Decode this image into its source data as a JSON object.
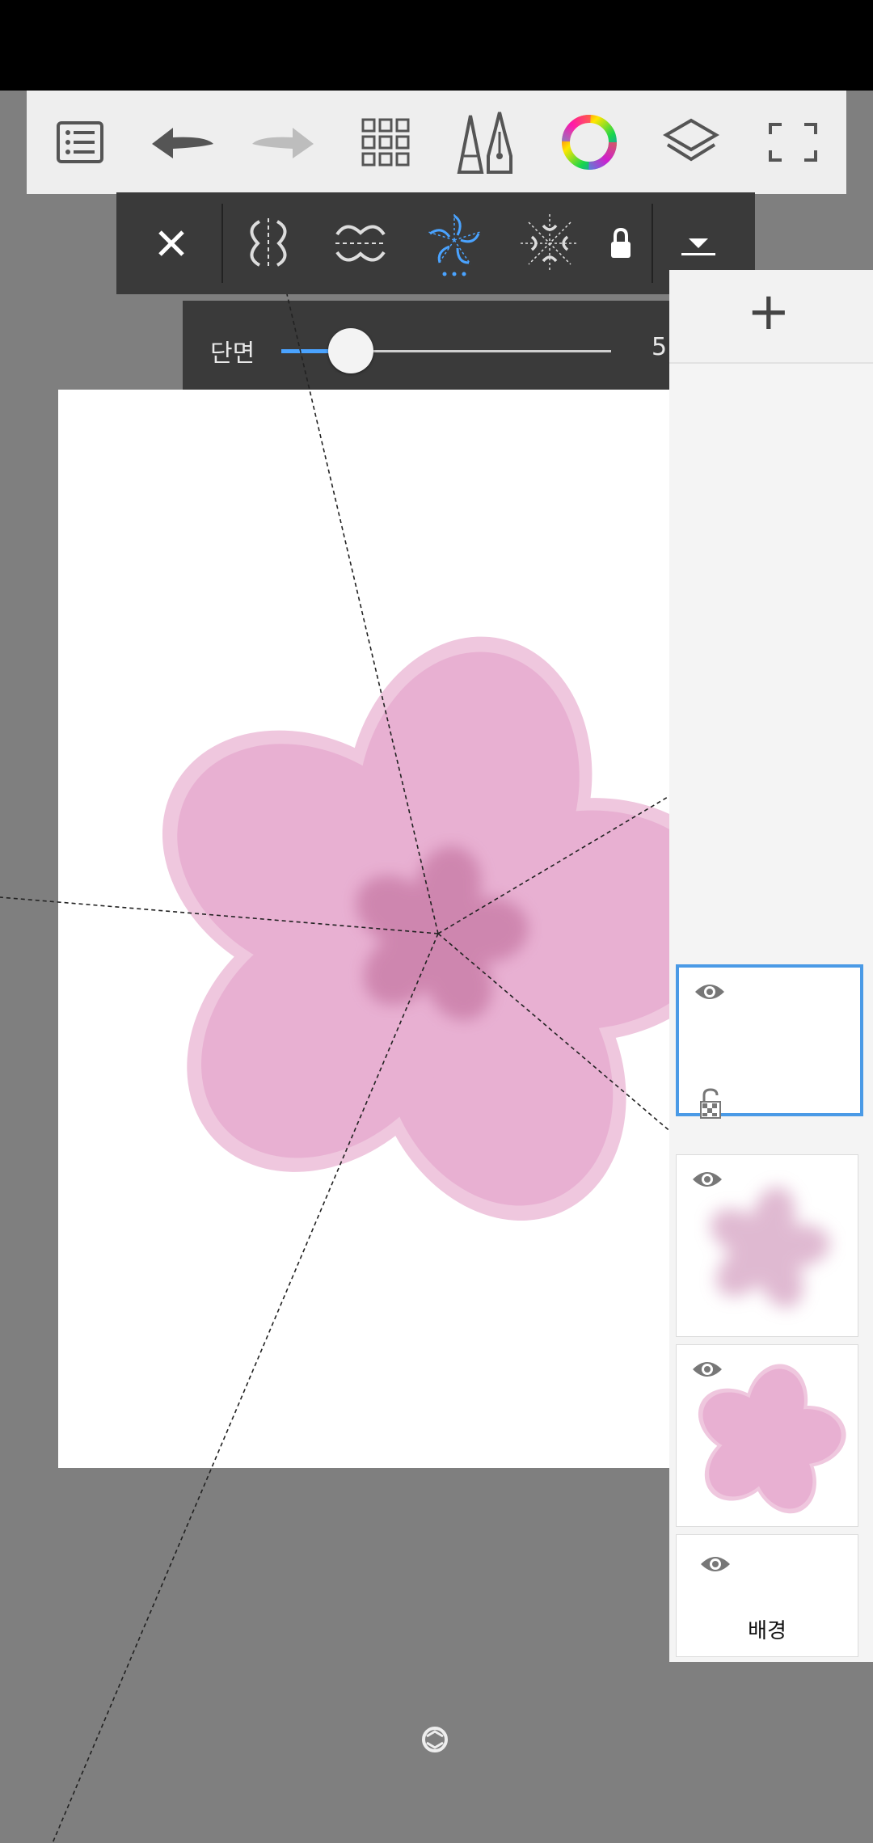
{
  "toolbar": {
    "buttons": [
      "menu",
      "undo",
      "redo",
      "grid",
      "brush-pen",
      "color-wheel",
      "layers",
      "fullscreen"
    ]
  },
  "symmetry_toolbar": {
    "close": "close-icon",
    "modes": [
      "symmetry-vertical",
      "symmetry-wave",
      "symmetry-radial",
      "symmetry-kaleidoscope"
    ],
    "active_mode": "symmetry-radial",
    "lock": "lock-icon",
    "dropdown": "chevron-down-icon"
  },
  "slider": {
    "label": "단면",
    "value": "5",
    "fraction": 0.21
  },
  "layers": {
    "add_label": "+",
    "items": [
      {
        "name": "",
        "selected": true
      },
      {
        "name": "",
        "selected": false
      },
      {
        "name": "",
        "selected": false
      },
      {
        "name": "배경",
        "selected": false
      }
    ]
  },
  "colors": {
    "accent": "#4aa3ff",
    "petal": "#e8b0d2",
    "petal_edge": "#efc7de",
    "center": "#cc82ac"
  }
}
